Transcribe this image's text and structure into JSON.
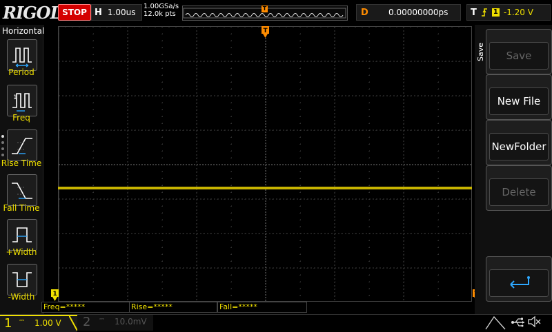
{
  "header": {
    "brand": "RIGOL",
    "run_status": "STOP",
    "timebase_tag": "H",
    "timebase_value": "1.00us",
    "sample_rate": "1.00GSa/s",
    "memory_depth": "12.0k pts",
    "trigger_position_marker": "T",
    "delay_tag": "D",
    "delay_value": "0.00000000ps",
    "trigger_tag": "T",
    "trigger_source": "1",
    "trigger_level": "-1.20 V"
  },
  "left_menu": {
    "title": "Horizontal",
    "items": [
      {
        "label": "Period",
        "icon": "period-icon"
      },
      {
        "label": "Freq",
        "icon": "frequency-icon"
      },
      {
        "label": "Rise Time",
        "icon": "rise-time-icon"
      },
      {
        "label": "Fall Time",
        "icon": "fall-time-icon"
      },
      {
        "label": "+Width",
        "icon": "positive-width-icon"
      },
      {
        "label": "-Width",
        "icon": "negative-width-icon"
      }
    ]
  },
  "measurements": {
    "freq": "Freq=*****",
    "rise": "Rise=*****",
    "fall": "Fall=*****"
  },
  "right_menu": {
    "title": "Save",
    "items": [
      {
        "label": "Save",
        "enabled": false
      },
      {
        "label": "New File",
        "enabled": true
      },
      {
        "label": "NewFolder",
        "enabled": true
      },
      {
        "label": "Delete",
        "enabled": false
      },
      {
        "label": "",
        "icon": "return-arrow-icon",
        "enabled": true
      }
    ]
  },
  "channels": {
    "ch1": {
      "number": "1",
      "scale": "1.00 V",
      "color": "#f0e000"
    },
    "ch2": {
      "number": "2",
      "scale": "10.0mV",
      "color": "#555555"
    }
  },
  "markers": {
    "ch1_ground": "1",
    "trigger_level": "T"
  },
  "colors": {
    "ch1": "#f0e000",
    "trace": "#c8b400",
    "stop": "#d40000",
    "delay": "#ff8c00",
    "trigger_marker": "#ff8c00"
  }
}
